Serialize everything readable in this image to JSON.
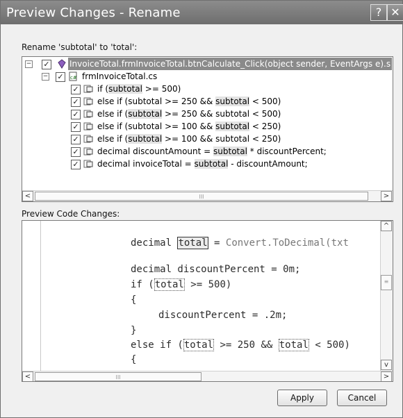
{
  "window": {
    "title": "Preview Changes - Rename",
    "help_glyph": "?",
    "close_glyph": "✕"
  },
  "rename_label": "Rename 'subtotal' to 'total':",
  "tree": {
    "root": {
      "text": "InvoiceTotal.frmInvoiceTotal.btnCalculate_Click(object sender, EventArgs e).s"
    },
    "file": {
      "text": "frmInvoiceTotal.cs"
    },
    "items": [
      {
        "prefix": "if (",
        "id": "subtotal",
        "suffix": " >= 500)"
      },
      {
        "prefix": "else if (",
        "id": "subtotal",
        "mid": " >= 250 && ",
        "id2": "subtotal",
        "suffix": " < 500)"
      },
      {
        "prefix": "else if (",
        "id": "subtotal",
        "mid": " >= 250 && ",
        "id2": "subtotal",
        "suffix": " < 500)"
      },
      {
        "prefix": "else if (",
        "id": "subtotal",
        "mid": " >= 100 && ",
        "id2": "subtotal",
        "suffix": " < 250)"
      },
      {
        "prefix": "else if (",
        "id": "subtotal",
        "mid": " >= 100 && ",
        "id2": "subtotal",
        "suffix": " < 250)"
      },
      {
        "prefix": "decimal discountAmount = ",
        "id": "subtotal",
        "suffix": " * discountPercent;"
      },
      {
        "prefix": "decimal invoiceTotal = ",
        "id": "subtotal",
        "suffix": " - discountAmount;"
      }
    ],
    "check_glyph": "✓",
    "expander_glyph": "−"
  },
  "preview_label": "Preview Code Changes:",
  "code": {
    "l1_a": "decimal ",
    "l1_id": "total",
    "l1_b": " = ",
    "l1_fn": "Convert.ToDecimal(txt",
    "l2": "decimal discountPercent = 0m;",
    "l3_a": "if (",
    "l3_id": "total",
    "l3_b": " >= 500)",
    "l4": "{",
    "l5": "discountPercent = .2m;",
    "l6": "}",
    "l7_a": "else if (",
    "l7_id": "total",
    "l7_b": " >= 250 && ",
    "l7_id2": "total",
    "l7_c": " < 500)",
    "l8": "{"
  },
  "scroll": {
    "left_arrow": "<",
    "right_arrow": ">",
    "up_arrow": "^",
    "down_arrow": "v",
    "grip": "III",
    "vgrip": "≡"
  },
  "buttons": {
    "apply": "Apply",
    "cancel": "Cancel"
  }
}
